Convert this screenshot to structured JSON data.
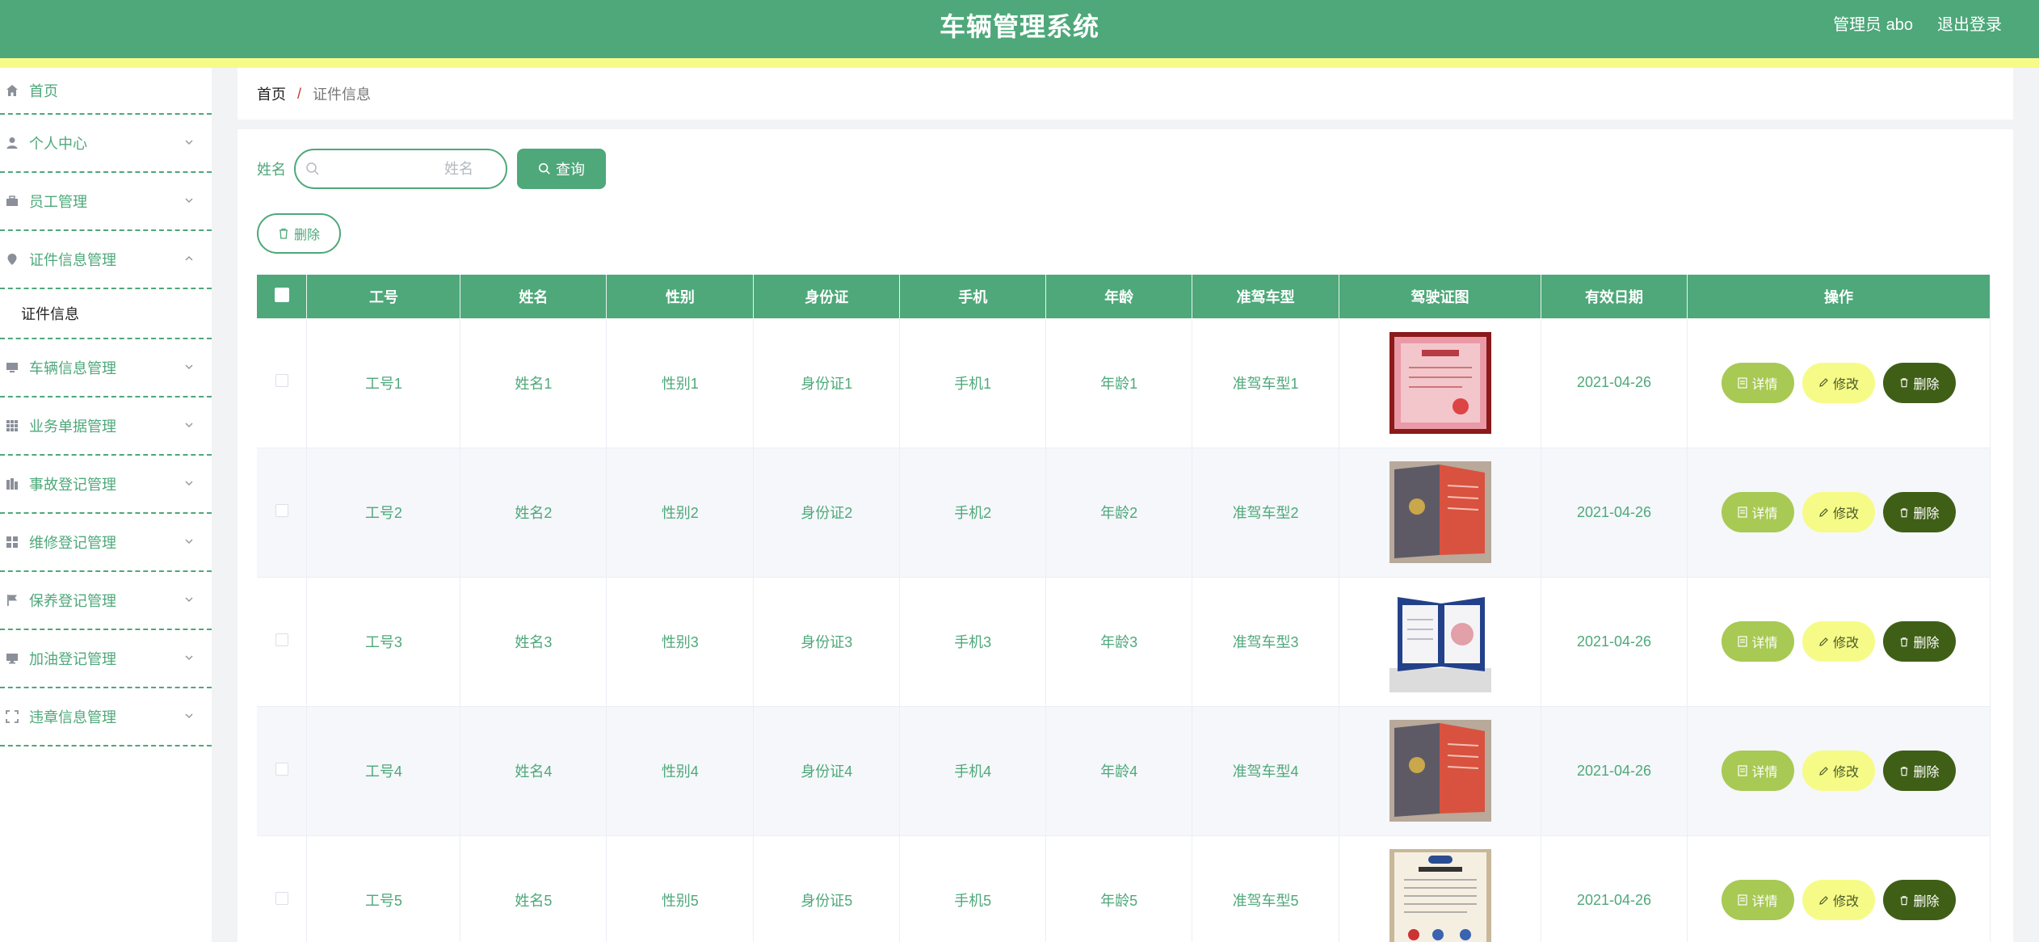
{
  "header": {
    "title": "车辆管理系统",
    "user": "管理员 abo",
    "logout": "退出登录"
  },
  "sidebar": {
    "items": [
      {
        "label": "首页",
        "icon": "home-icon"
      },
      {
        "label": "个人中心",
        "icon": "user-icon"
      },
      {
        "label": "员工管理",
        "icon": "briefcase-icon"
      },
      {
        "label": "证件信息管理",
        "icon": "pin-icon"
      },
      {
        "label": "车辆信息管理",
        "icon": "monitor-icon"
      },
      {
        "label": "业务单据管理",
        "icon": "grid-icon"
      },
      {
        "label": "事故登记管理",
        "icon": "office-icon"
      },
      {
        "label": "维修登记管理",
        "icon": "squares-icon"
      },
      {
        "label": "保养登记管理",
        "icon": "flag-icon"
      },
      {
        "label": "加油登记管理",
        "icon": "display-icon"
      },
      {
        "label": "违章信息管理",
        "icon": "fullscreen-icon"
      }
    ],
    "submenu": {
      "label": "证件信息"
    }
  },
  "breadcrumb": {
    "home": "首页",
    "separator": "/",
    "current": "证件信息"
  },
  "search": {
    "label": "姓名",
    "placeholder": "姓名",
    "query_label": "查询"
  },
  "toolbar": {
    "delete_label": "删除"
  },
  "table": {
    "headers": [
      "工号",
      "姓名",
      "性别",
      "身份证",
      "手机",
      "年龄",
      "准驾车型",
      "驾驶证图",
      "有效日期",
      "操作"
    ],
    "rows": [
      {
        "id": "工号1",
        "name": "姓名1",
        "gender": "性别1",
        "idcard": "身份证1",
        "phone": "手机1",
        "age": "年龄1",
        "type": "准驾车型1",
        "date": "2021-04-26"
      },
      {
        "id": "工号2",
        "name": "姓名2",
        "gender": "性别2",
        "idcard": "身份证2",
        "phone": "手机2",
        "age": "年龄2",
        "type": "准驾车型2",
        "date": "2021-04-26"
      },
      {
        "id": "工号3",
        "name": "姓名3",
        "gender": "性别3",
        "idcard": "身份证3",
        "phone": "手机3",
        "age": "年龄3",
        "type": "准驾车型3",
        "date": "2021-04-26"
      },
      {
        "id": "工号4",
        "name": "姓名4",
        "gender": "性别4",
        "idcard": "身份证4",
        "phone": "手机4",
        "age": "年龄4",
        "type": "准驾车型4",
        "date": "2021-04-26"
      },
      {
        "id": "工号5",
        "name": "姓名5",
        "gender": "性别5",
        "idcard": "身份证5",
        "phone": "手机5",
        "age": "年龄5",
        "type": "准驾车型5",
        "date": "2021-04-26"
      }
    ],
    "actions": {
      "detail": "详情",
      "edit": "修改",
      "delete": "删除"
    }
  },
  "colors": {
    "primary": "#4ea87a",
    "accent": "#f6fb87",
    "detail": "#a8c954",
    "danger": "#3f5f17"
  }
}
